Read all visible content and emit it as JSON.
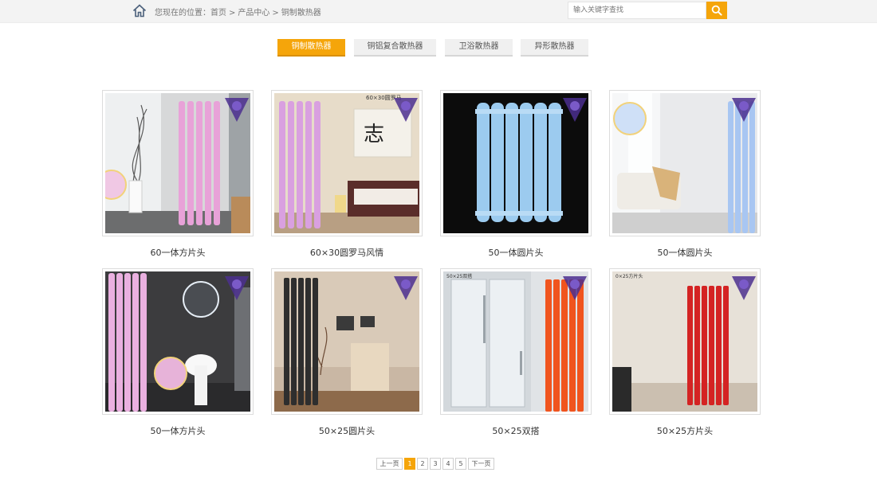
{
  "breadcrumb": {
    "prefix": "您现在的位置：",
    "items": [
      "首页",
      "产品中心",
      "铜制散热器"
    ],
    "separator": ">"
  },
  "search": {
    "placeholder": "输入关键字查找",
    "value": ""
  },
  "icons": {
    "home": "home-icon",
    "search": "search-icon",
    "watermark": "brand-logo-icon"
  },
  "tabs": [
    {
      "label": "铜制散热器",
      "active": true
    },
    {
      "label": "铜铝复合散热器",
      "active": false
    },
    {
      "label": "卫浴散热器",
      "active": false
    },
    {
      "label": "异形散热器",
      "active": false
    }
  ],
  "products": [
    {
      "name": "60一体方片头",
      "radiator_color": "#e8a2d8",
      "photo_label": ""
    },
    {
      "name": "60×30圆罗马风情",
      "radiator_color": "#d9a0e0",
      "photo_label": "60×30圆罗马"
    },
    {
      "name": "50一体圆片头",
      "radiator_color": "#9ccbef",
      "photo_label": ""
    },
    {
      "name": "50一体圆片头",
      "radiator_color": "#a8c6f2",
      "photo_label": ""
    },
    {
      "name": "50一体方片头",
      "radiator_color": "#eab0e0",
      "photo_label": ""
    },
    {
      "name": "50×25圆片头",
      "radiator_color": "#2e2e2e",
      "photo_label": ""
    },
    {
      "name": "50×25双搭",
      "radiator_color": "#f0541e",
      "photo_label": "50×25双搭"
    },
    {
      "name": "50×25方片头",
      "radiator_color": "#d42323",
      "photo_label": "0×25方片头"
    }
  ],
  "pagination": {
    "prev": "上一页",
    "pages": [
      "1",
      "2",
      "3",
      "4",
      "5"
    ],
    "current": "1",
    "next": "下一页"
  },
  "colors": {
    "accent": "#f5a50a",
    "topbar": "#f3f3f3"
  }
}
